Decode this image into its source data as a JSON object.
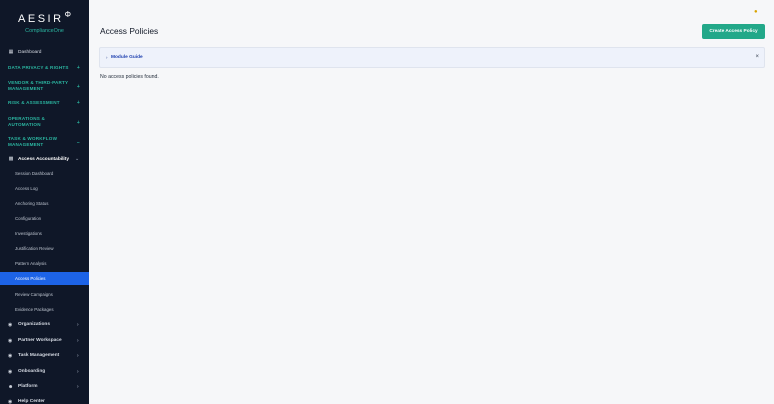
{
  "logo": {
    "brand": "AESIR",
    "mark": "Φ",
    "sub": "ComplianceOne"
  },
  "nav": {
    "dashboard": "Dashboard",
    "sections": {
      "privacy": "DATA PRIVACY & RIGHTS",
      "vendor_1": "VENDOR & THIRD-PARTY",
      "vendor_2": "MANAGEMENT",
      "risk": "RISK & ASSESSMENT",
      "ops_1": "OPERATIONS &",
      "ops_2": "AUTOMATION",
      "task_1": "TASK & WORKFLOW",
      "task_2": "MANAGEMENT"
    },
    "group": "Access Accountability",
    "sub_items": {
      "session": "Session Dashboard",
      "log": "Access Log",
      "anchoring": "Anchoring Status",
      "config": "Configuration",
      "investigations": "Investigations",
      "justification": "Justification Review",
      "pattern": "Pattern Analysis",
      "policies": "Access Policies",
      "review": "Review Campaigns",
      "evidence": "Evidence Packages"
    },
    "bottom": {
      "organizations": "Organizations",
      "partner": "Partner Workspace",
      "task": "Task Management",
      "onboarding": "Onboarding",
      "platform": "Platform",
      "help": "Help Center"
    }
  },
  "main": {
    "title": "Access Policies",
    "create_label": "Create Access Policy",
    "guide_label": "Module Guide",
    "empty_text": "No access policies found."
  },
  "colors": {
    "accent": "#22a889",
    "sidebar": "#0f1728",
    "active": "#1d63e6",
    "section": "#2bb6a1"
  }
}
